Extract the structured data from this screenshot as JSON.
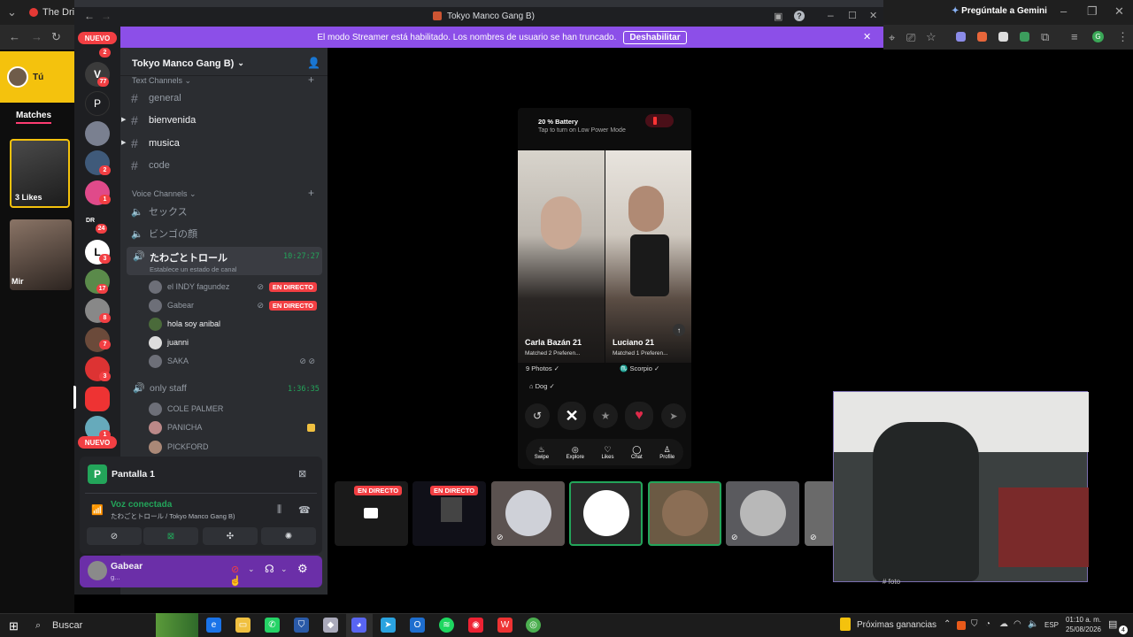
{
  "browser": {
    "tab_title": "The Drive",
    "gemini": "Pregúntale a Gemini",
    "avatar_letter": "G"
  },
  "left_page": {
    "tu": "Tú",
    "matches_tab": "Matches",
    "likes_label": "3 Likes",
    "person_label": "Mir"
  },
  "discord": {
    "window_title": "Tokyo Manco Gang B)",
    "streamer_notice": "El modo Streamer está habilitado. Los nombres de usuario se han truncado.",
    "disable_button": "Deshabilitar",
    "server_name": "Tokyo Manco Gang B)",
    "nuevo": "NUEVO",
    "rail_badges": [
      "2",
      "77",
      "2",
      "1",
      "24",
      "3",
      "17",
      "8",
      "7",
      "3",
      "1"
    ],
    "rail_letter_p": "P",
    "rail_dr": "DR",
    "text_category": "Text Channels",
    "text_channels": [
      "general",
      "bienvenida",
      "musica",
      "code"
    ],
    "voice_category": "Voice Channels",
    "voice_channels": [
      "セックス",
      "ビンゴの顔"
    ],
    "active_voice": {
      "name": "たわごとトロール",
      "time": "10:27:27",
      "status": "Establece un estado de canal"
    },
    "active_users": [
      {
        "name": "el INDY fagundez",
        "live": "EN DIRECTO"
      },
      {
        "name": "Gabear",
        "live": "EN DIRECTO"
      },
      {
        "name": "hola soy anibal"
      },
      {
        "name": "juanni"
      },
      {
        "name": "SAKA"
      }
    ],
    "staff_voice": {
      "name": "only staff",
      "time": "1:36:35"
    },
    "staff_users": [
      "COLE PALMER",
      "PANICHA",
      "PICKFORD"
    ],
    "stream_panel": {
      "title": "Pantalla 1",
      "voice_status": "Voz conectada",
      "voice_location": "たわごとトロール / Tokyo Manco Gang B)"
    },
    "user": {
      "name": "Gabear",
      "status": "g..."
    }
  },
  "phone": {
    "battery_title": "20 % Battery",
    "battery_sub": "Tap to turn on Low Power Mode",
    "profiles": [
      {
        "name": "Carla Bazán",
        "age": "21",
        "match": "Matched 2 Preferen...",
        "tags": [
          "9 Photos",
          "Dog"
        ]
      },
      {
        "name": "Luciano",
        "age": "21",
        "match": "Matched 1 Preferen...",
        "tags": [
          "Scorpio"
        ]
      }
    ],
    "nav": [
      "Swipe",
      "Explore",
      "Likes",
      "Chat",
      "Profile"
    ]
  },
  "tiles": {
    "live_label": "EN DIRECTO"
  },
  "webcam_caption": "# foto",
  "taskbar": {
    "search": "Buscar",
    "weather": "Próximas ganancias",
    "lang": "ESP",
    "time": "01:10 a. m.",
    "date": "25/08/2026",
    "notif_count": "4"
  }
}
